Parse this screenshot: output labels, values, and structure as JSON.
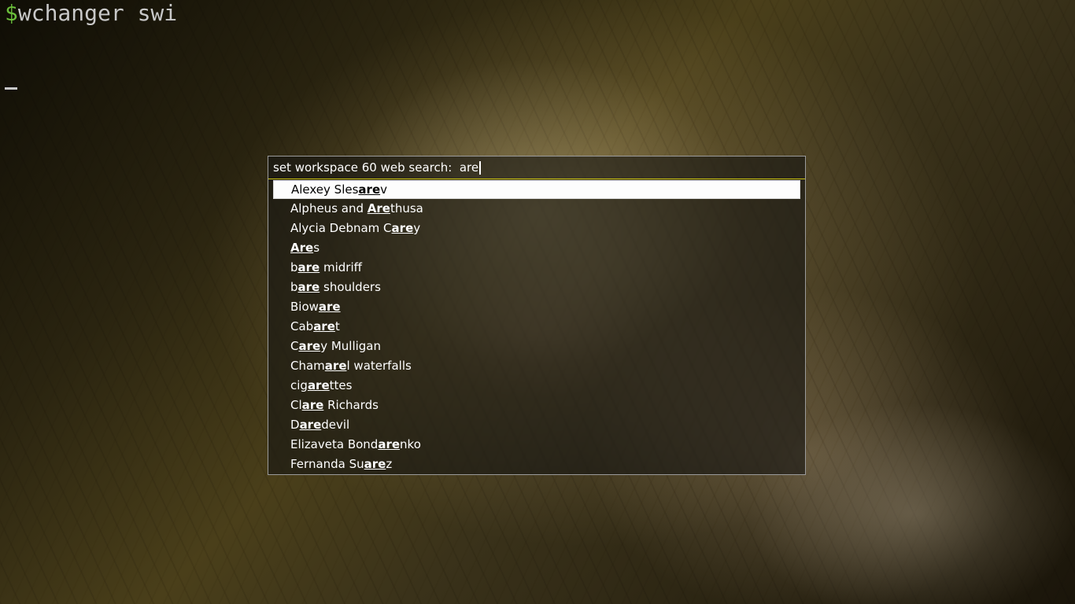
{
  "terminal": {
    "prompt_symbol": "$",
    "command": "wchanger swi"
  },
  "dmenu": {
    "prompt": "set workspace 60 web search:  ",
    "query": "are",
    "items": [
      {
        "segments": [
          {
            "t": "Alexey Sles",
            "m": false
          },
          {
            "t": "are",
            "m": true
          },
          {
            "t": "v",
            "m": false
          }
        ],
        "selected": true
      },
      {
        "segments": [
          {
            "t": "Alpheus and ",
            "m": false
          },
          {
            "t": "Are",
            "m": true
          },
          {
            "t": "thusa",
            "m": false
          }
        ],
        "selected": false
      },
      {
        "segments": [
          {
            "t": "Alycia Debnam C",
            "m": false
          },
          {
            "t": "are",
            "m": true
          },
          {
            "t": "y",
            "m": false
          }
        ],
        "selected": false
      },
      {
        "segments": [
          {
            "t": "Are",
            "m": true
          },
          {
            "t": "s",
            "m": false
          }
        ],
        "selected": false
      },
      {
        "segments": [
          {
            "t": "b",
            "m": false
          },
          {
            "t": "are",
            "m": true
          },
          {
            "t": " midriff",
            "m": false
          }
        ],
        "selected": false
      },
      {
        "segments": [
          {
            "t": "b",
            "m": false
          },
          {
            "t": "are",
            "m": true
          },
          {
            "t": " shoulders",
            "m": false
          }
        ],
        "selected": false
      },
      {
        "segments": [
          {
            "t": "Biow",
            "m": false
          },
          {
            "t": "are",
            "m": true
          }
        ],
        "selected": false
      },
      {
        "segments": [
          {
            "t": "Cab",
            "m": false
          },
          {
            "t": "are",
            "m": true
          },
          {
            "t": "t",
            "m": false
          }
        ],
        "selected": false
      },
      {
        "segments": [
          {
            "t": "C",
            "m": false
          },
          {
            "t": "are",
            "m": true
          },
          {
            "t": "y Mulligan",
            "m": false
          }
        ],
        "selected": false
      },
      {
        "segments": [
          {
            "t": "Cham",
            "m": false
          },
          {
            "t": "are",
            "m": true
          },
          {
            "t": "l waterfalls",
            "m": false
          }
        ],
        "selected": false
      },
      {
        "segments": [
          {
            "t": "cig",
            "m": false
          },
          {
            "t": "are",
            "m": true
          },
          {
            "t": "ttes",
            "m": false
          }
        ],
        "selected": false
      },
      {
        "segments": [
          {
            "t": "Cl",
            "m": false
          },
          {
            "t": "are",
            "m": true
          },
          {
            "t": " Richards",
            "m": false
          }
        ],
        "selected": false
      },
      {
        "segments": [
          {
            "t": "D",
            "m": false
          },
          {
            "t": "are",
            "m": true
          },
          {
            "t": "devil",
            "m": false
          }
        ],
        "selected": false
      },
      {
        "segments": [
          {
            "t": "Elizaveta Bond",
            "m": false
          },
          {
            "t": "are",
            "m": true
          },
          {
            "t": "nko",
            "m": false
          }
        ],
        "selected": false
      },
      {
        "segments": [
          {
            "t": "Fernanda Su",
            "m": false
          },
          {
            "t": "are",
            "m": true
          },
          {
            "t": "z",
            "m": false
          }
        ],
        "selected": false
      }
    ]
  }
}
